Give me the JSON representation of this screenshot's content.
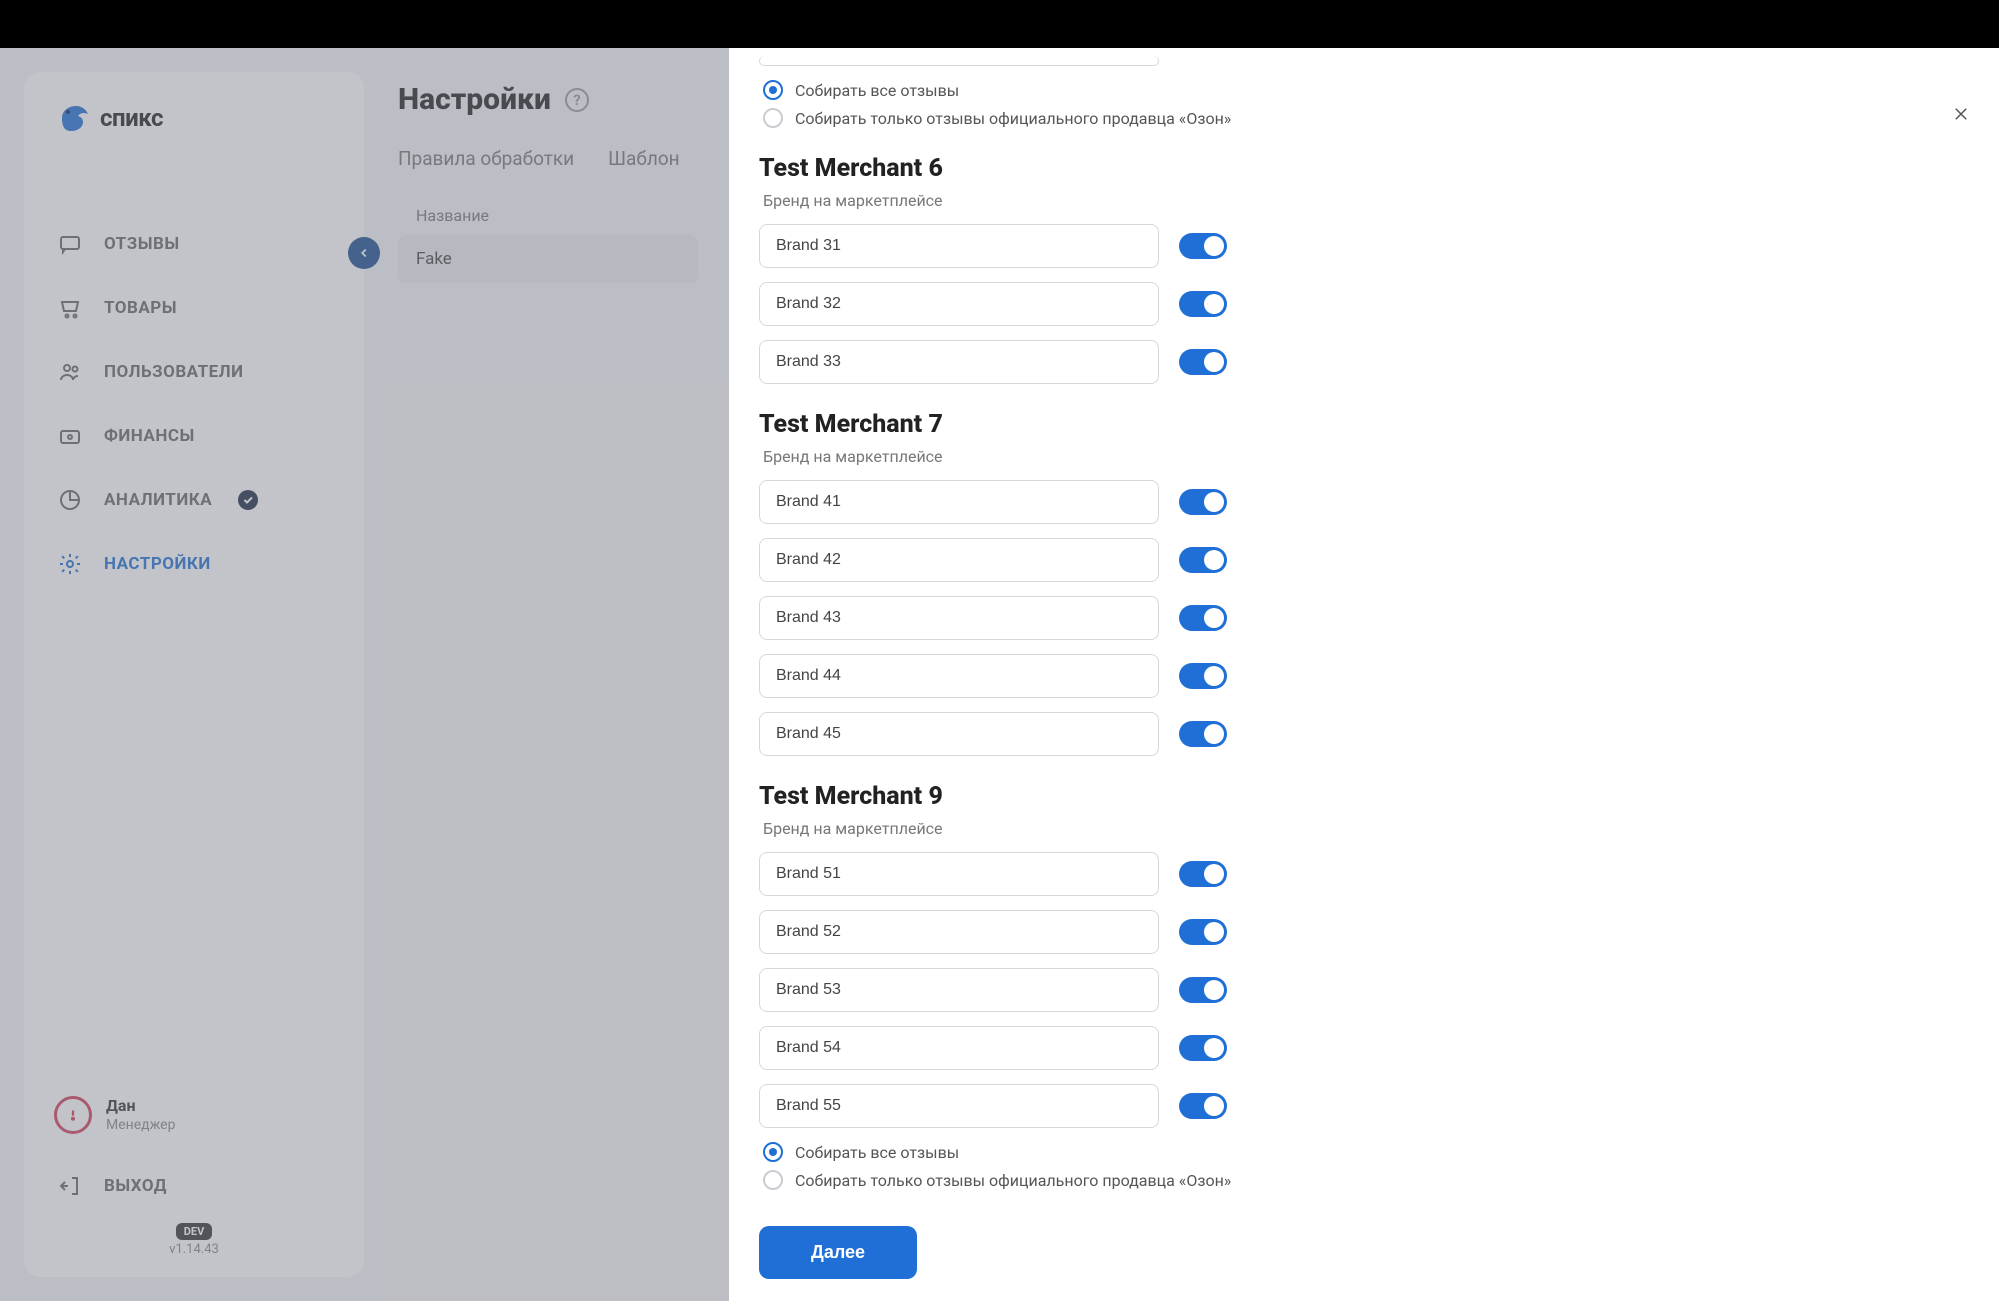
{
  "brand": {
    "name": "спикс"
  },
  "sidebar": {
    "items": [
      {
        "label": "ОТЗЫВЫ",
        "icon": "comment-icon"
      },
      {
        "label": "ТОВАРЫ",
        "icon": "cart-icon"
      },
      {
        "label": "ПОЛЬЗОВАТЕЛИ",
        "icon": "users-icon"
      },
      {
        "label": "ФИНАНСЫ",
        "icon": "money-icon"
      },
      {
        "label": "АНАЛИТИКА",
        "icon": "analytics-icon",
        "badge": true
      },
      {
        "label": "НАСТРОЙКИ",
        "icon": "settings-icon",
        "active": true
      }
    ],
    "user": {
      "name": "Дан",
      "role": "Менеджер"
    },
    "logout_label": "ВЫХОД",
    "dev_badge": "DEV",
    "version": "v1.14.43"
  },
  "page": {
    "title": "Настройки",
    "tabs": [
      {
        "label": "Правила обработки"
      },
      {
        "label": "Шаблон"
      }
    ],
    "column_header": "Название",
    "rows": [
      {
        "name": "Fake"
      }
    ]
  },
  "panel": {
    "radio_all": "Собирать все отзывы",
    "radio_official": "Собирать только отзывы официального продавца «Озон»",
    "brand_sub": "Бренд на маркетплейсе",
    "merchants": [
      {
        "title": "Test Merchant 6",
        "brands": [
          {
            "name": "Brand 31",
            "on": true
          },
          {
            "name": "Brand 32",
            "on": true
          },
          {
            "name": "Brand 33",
            "on": true
          }
        ]
      },
      {
        "title": "Test Merchant 7",
        "brands": [
          {
            "name": "Brand 41",
            "on": true
          },
          {
            "name": "Brand 42",
            "on": true
          },
          {
            "name": "Brand 43",
            "on": true
          },
          {
            "name": "Brand 44",
            "on": true
          },
          {
            "name": "Brand 45",
            "on": true
          }
        ]
      },
      {
        "title": "Test Merchant 9",
        "brands": [
          {
            "name": "Brand 51",
            "on": true
          },
          {
            "name": "Brand 52",
            "on": true
          },
          {
            "name": "Brand 53",
            "on": true
          },
          {
            "name": "Brand 54",
            "on": true
          },
          {
            "name": "Brand 55",
            "on": true
          }
        ]
      }
    ],
    "next_button": "Далее"
  }
}
